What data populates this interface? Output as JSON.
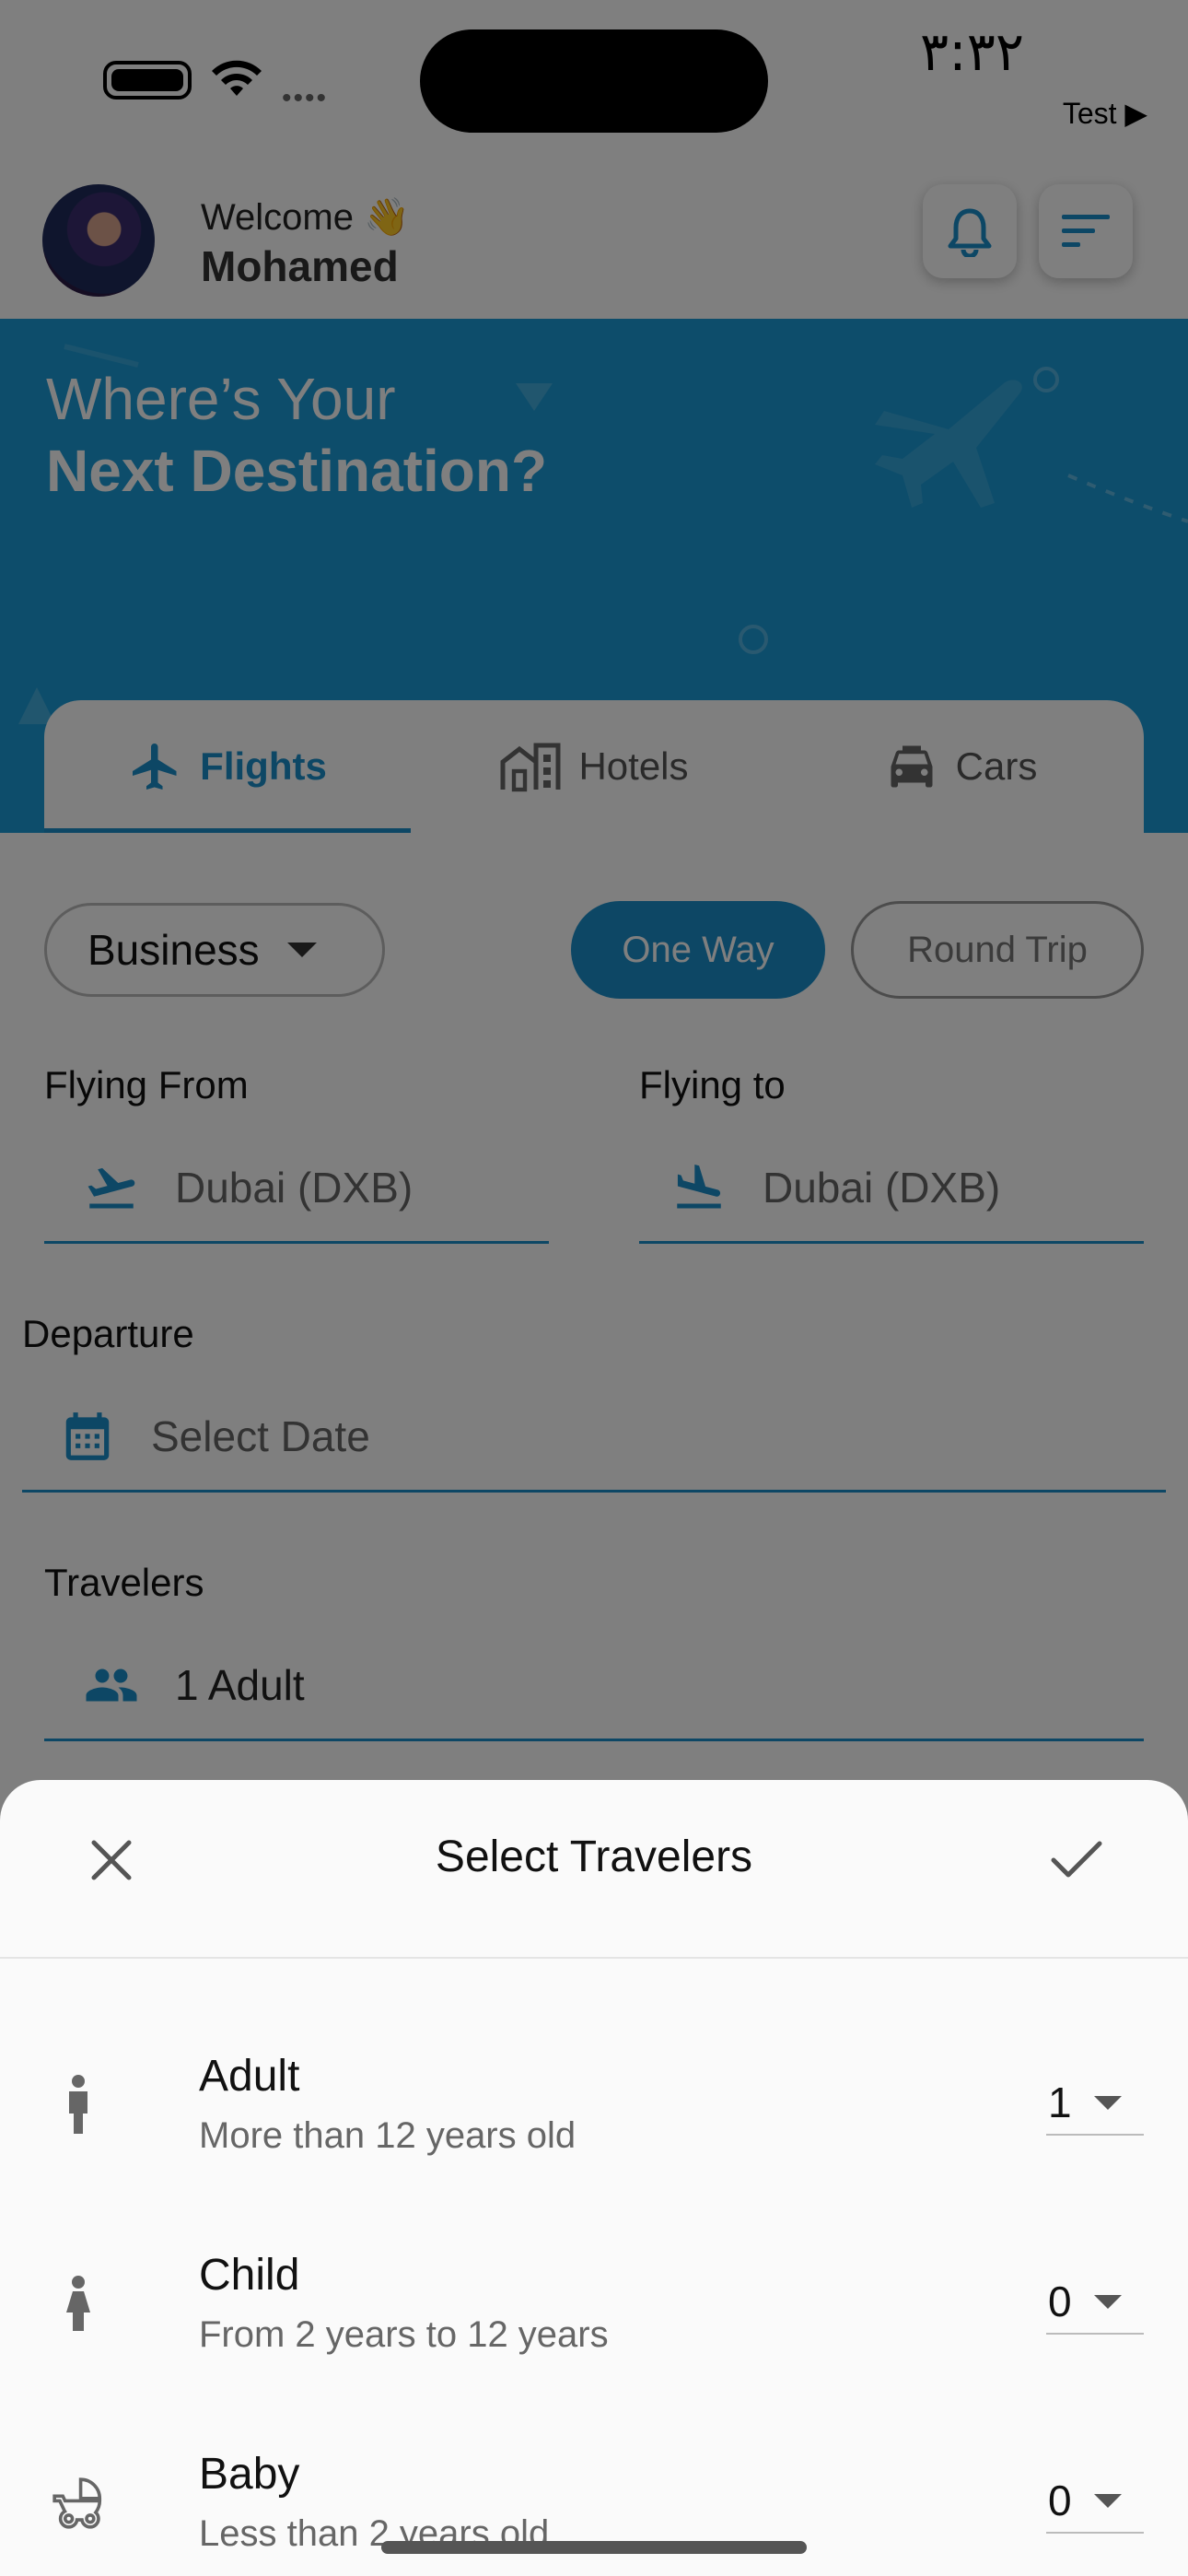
{
  "status_bar": {
    "time": "٣:٣٢",
    "carrier": "Test ▶"
  },
  "header": {
    "welcome": "Welcome 👋",
    "user_name": "Mohamed"
  },
  "hero": {
    "line1": "Where’s Your",
    "line2": "Next Destination?"
  },
  "tabs": [
    {
      "label": "Flights",
      "icon": "airplane-icon",
      "active": true
    },
    {
      "label": "Hotels",
      "icon": "hotel-icon",
      "active": false
    },
    {
      "label": "Cars",
      "icon": "car-icon",
      "active": false
    }
  ],
  "form": {
    "cabin_class": "Business",
    "trip_types": {
      "one_way": "One Way",
      "round_trip": "Round Trip",
      "selected": "One Way"
    },
    "flying_from": {
      "label": "Flying From",
      "value": "Dubai (DXB)"
    },
    "flying_to": {
      "label": "Flying to",
      "value": "Dubai (DXB)"
    },
    "departure": {
      "label": "Departure",
      "placeholder": "Select Date"
    },
    "travelers": {
      "label": "Travelers",
      "value": "1 Adult"
    }
  },
  "sheet": {
    "title": "Select Travelers",
    "rows": [
      {
        "name": "Adult",
        "desc": "More than 12 years old",
        "count": "1",
        "icon": "adult-icon"
      },
      {
        "name": "Child",
        "desc": "From 2 years to 12 years",
        "count": "0",
        "icon": "child-icon"
      },
      {
        "name": "Baby",
        "desc": "Less than 2 years old",
        "count": "0",
        "icon": "stroller-icon"
      }
    ]
  },
  "colors": {
    "primary": "#1a8fcb",
    "hero_bg": "#1a9ad6",
    "sheet_bg": "#fafafa"
  }
}
